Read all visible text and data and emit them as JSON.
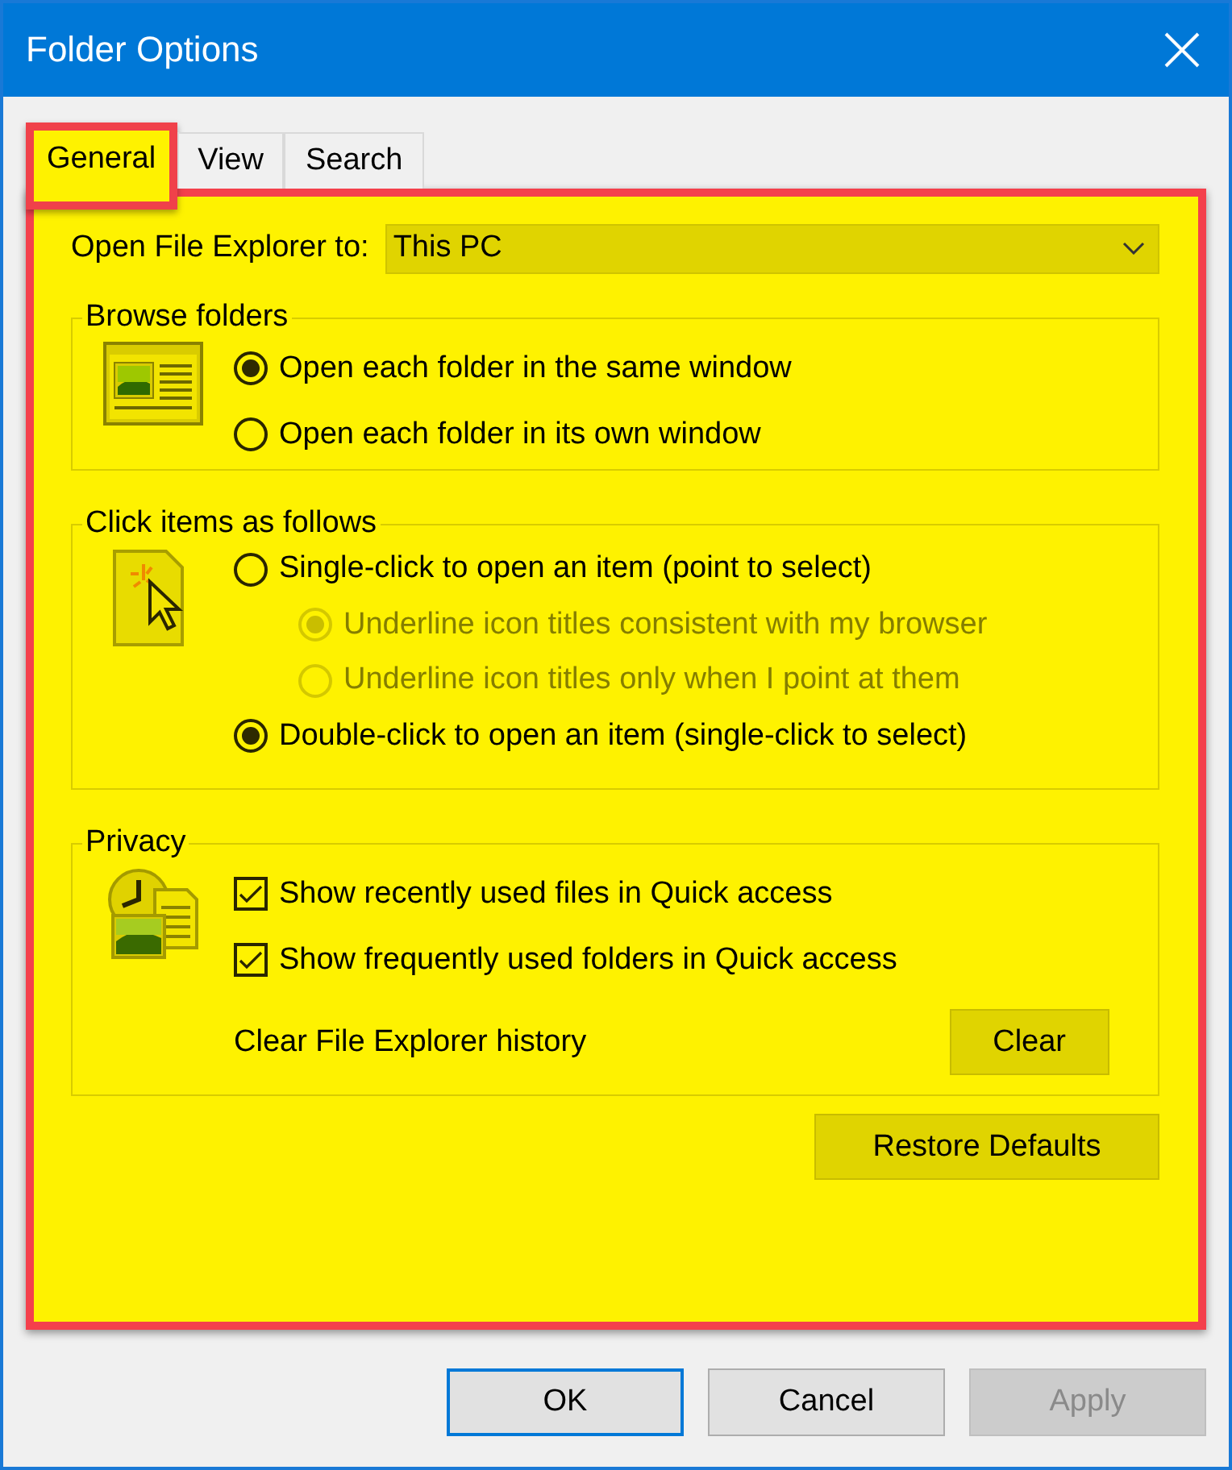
{
  "window": {
    "title": "Folder Options"
  },
  "tabs": [
    {
      "label": "General",
      "selected": true,
      "highlighted": true
    },
    {
      "label": "View",
      "selected": false,
      "highlighted": false
    },
    {
      "label": "Search",
      "selected": false,
      "highlighted": false
    }
  ],
  "panel": {
    "highlighted": true
  },
  "open_to": {
    "label": "Open File Explorer to:",
    "value": "This PC"
  },
  "browse_folders": {
    "title": "Browse folders",
    "options": [
      {
        "label": "Open each folder in the same window",
        "selected": true,
        "disabled": false
      },
      {
        "label": "Open each folder in its own window",
        "selected": false,
        "disabled": false
      }
    ]
  },
  "click_items": {
    "title": "Click items as follows",
    "options": [
      {
        "label": "Single-click to open an item (point to select)",
        "selected": false,
        "disabled": false,
        "children": [
          {
            "label": "Underline icon titles consistent with my browser",
            "selected": true,
            "disabled": true
          },
          {
            "label": "Underline icon titles only when I point at them",
            "selected": false,
            "disabled": true
          }
        ]
      },
      {
        "label": "Double-click to open an item (single-click to select)",
        "selected": true,
        "disabled": false
      }
    ]
  },
  "privacy": {
    "title": "Privacy",
    "options": [
      {
        "label": "Show recently used files in Quick access",
        "checked": true
      },
      {
        "label": "Show frequently used folders in Quick access",
        "checked": true
      }
    ],
    "clear_label": "Clear File Explorer history",
    "clear_button": "Clear"
  },
  "restore_button": "Restore Defaults",
  "buttons": [
    {
      "label": "OK",
      "kind": "default",
      "disabled": false
    },
    {
      "label": "Cancel",
      "kind": "normal",
      "disabled": false
    },
    {
      "label": "Apply",
      "kind": "normal",
      "disabled": true
    }
  ]
}
